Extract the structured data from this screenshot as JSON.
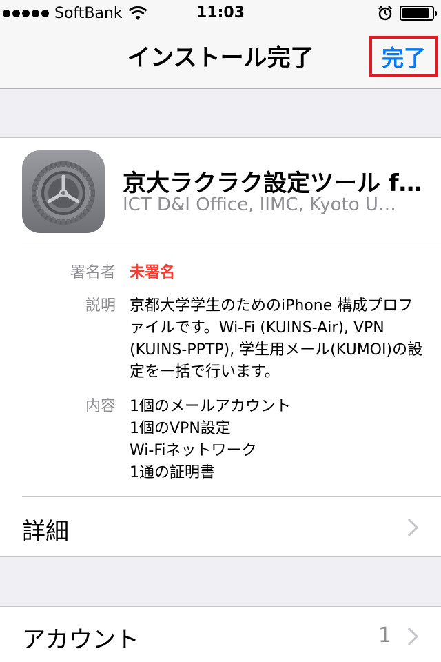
{
  "status_bar": {
    "carrier": "SoftBank",
    "time": "11:03",
    "signal_bars": 5,
    "battery_level": 0.9
  },
  "nav": {
    "title": "インストール完了",
    "done_label": "完了",
    "accent_color": "#007aff",
    "highlight_color": "#e01b24"
  },
  "profile": {
    "name": "京大ラクラク設定ツール f…",
    "organization": "ICT D&I Office, IIMC, Kyoto U…",
    "icon": "settings-gear-icon"
  },
  "details": {
    "signer_label": "署名者",
    "signer_value": "未署名",
    "description_label": "説明",
    "description_value": "京都大学学生のためのiPhone 構成プロファイルです。Wi-Fi (KUINS-Air), VPN (KUINS-PPTP), 学生用メール(KUMOI)の設定を一括で行います。",
    "contents_label": "内容",
    "contents": [
      "1個のメールアカウント",
      "1個のVPN設定",
      "Wi-Fiネットワーク",
      "1通の証明書"
    ]
  },
  "more_details_label": "詳細",
  "account": {
    "label": "アカウント",
    "count": "1"
  }
}
